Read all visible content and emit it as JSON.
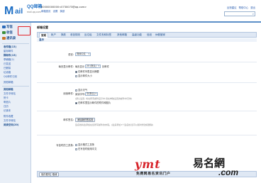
{
  "header": {
    "logo_mark": "M",
    "logo_rest": "ail",
    "brand": "QQ邮箱",
    "domain": "mail.qq.com",
    "account": "00000000000<0730073@qq.com>",
    "account_links": [
      "邮箱首页",
      "设置",
      "换肤"
    ],
    "top_links": [
      "反馈建议",
      "帮助中心",
      "退出"
    ],
    "search_icon": "search-icon"
  },
  "sidebar": {
    "primary": [
      {
        "label": "写信",
        "icon": "write-icon",
        "color": "#2a6ab8"
      },
      {
        "label": "收信",
        "icon": "inbox-icon",
        "color": "#3b8f3b"
      },
      {
        "label": "通讯录",
        "icon": "contacts-icon",
        "color": "#c8742a"
      }
    ],
    "folders": [
      "收件箱(13)",
      "星标邮件",
      "群邮件(15)",
      "草稿箱(2)",
      "已发送",
      "已删除",
      "垃圾箱",
      "QQ邮件订阅"
    ],
    "more_folders": [
      "其他邮箱",
      "文件中转站",
      "贺卡",
      "明信片",
      "日历",
      "记事本"
    ],
    "bottom": [
      "附件收藏",
      "文件中转站",
      "阅读空间(20)"
    ],
    "group_label": "其他邮箱"
  },
  "main": {
    "page_title": "邮箱设置",
    "tabs": [
      "常规",
      "帐户",
      "换肤",
      "收信规则",
      "反垃圾",
      "文件夹和标签",
      "其他邮箱",
      "高级功能",
      "信纸",
      "休假管家"
    ],
    "active_tab": "常规",
    "section_title": "显示",
    "rows": {
      "row1": {
        "label": "语言:",
        "select": "简体中文"
      },
      "row2": {
        "label": "每页显示邮件:",
        "prefix": "每页显示",
        "select": "25 (默认)",
        "suffix": "封邮件",
        "options": [
          "在邮件列表显示摘要",
          "显示邮件大小"
        ]
      },
      "row3": {
        "label": "阅读邮件:",
        "options": [
          "显示天气",
          "显示邮件头像"
        ],
        "charset_prefix": "阅读字号:",
        "charset_select": "中(默认)",
        "note": "(默认设置, 将在所有邮件显示中,但在单独设置的邮件中无效)",
        "option_last": "在邮件里显示邮件的附件和图片"
      },
      "row4": {
        "label": "邮件签名:",
        "button": "添加新的签名档",
        "note": "签名档将会添加在您所写邮件的末尾。(最多添加3个签名档,您可以随时修改和删除)"
      },
      "row5": {
        "label": "写信时的工具条:",
        "options": [
          "显示格式工具条",
          "在写信时使用中文"
        ]
      }
    },
    "save_label": "保存更改",
    "cancel_label": "取消"
  },
  "watermark": {
    "latin": "ymt",
    "cn": "易名網",
    "com": ".com",
    "tagline": "免费网易名资讯门户"
  },
  "colors": {
    "accent": "#1e6fc5",
    "highlight_box": "#e2242a",
    "tabbar": "#dfe8f4"
  }
}
